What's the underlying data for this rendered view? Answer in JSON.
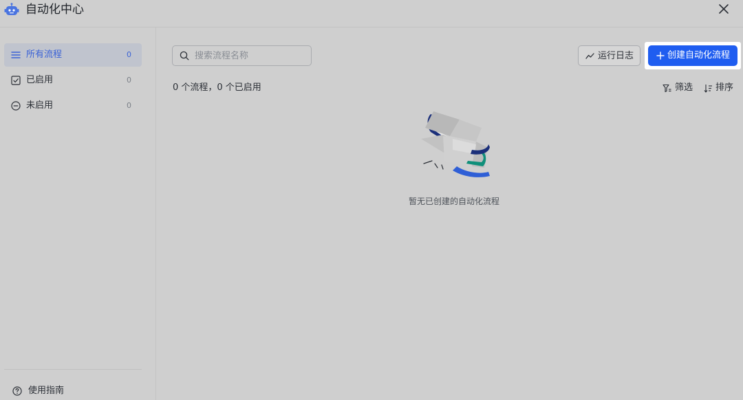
{
  "header": {
    "title": "自动化中心",
    "logo_icon": "robot-icon",
    "close_icon": "close-icon"
  },
  "sidebar": {
    "items": [
      {
        "label": "所有流程",
        "count": "0",
        "icon": "list-icon",
        "active": true
      },
      {
        "label": "已启用",
        "count": "0",
        "icon": "checkbox-checked-icon",
        "active": false
      },
      {
        "label": "未启用",
        "count": "0",
        "icon": "minus-circle-icon",
        "active": false
      }
    ],
    "guide": {
      "label": "使用指南",
      "icon": "help-circle-icon"
    }
  },
  "toolbar": {
    "search_placeholder": "搜索流程名称",
    "log_label": "运行日志",
    "create_label": "创建自动化流程"
  },
  "summary": {
    "text": "0 个流程，0 个已启用",
    "filter_label": "筛选",
    "sort_label": "排序"
  },
  "empty_state": {
    "message": "暂无已创建的自动化流程"
  },
  "colors": {
    "accent": "#1f5df0",
    "active_text": "#3a62d6",
    "active_bg": "#c0c4ce",
    "background": "#cfcfcf"
  }
}
